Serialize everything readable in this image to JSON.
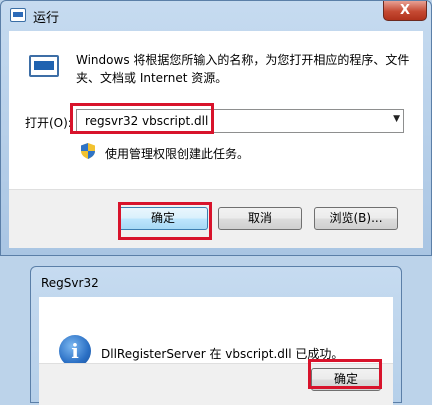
{
  "run_dialog": {
    "title": "运行",
    "close_glyph": "X",
    "description": "Windows 将根据您所输入的名称，为您打开相应的程序、文件夹、文档或 Internet 资源。",
    "open_label": "打开(O):",
    "command_value": "regsvr32 vbscript.dll",
    "admin_note": "使用管理权限创建此任务。",
    "buttons": {
      "ok": "确定",
      "cancel": "取消",
      "browse": "浏览(B)..."
    },
    "highlight_color": "#d8132b"
  },
  "regsvr_dialog": {
    "title": "RegSvr32",
    "message": "DllRegisterServer 在 vbscript.dll 已成功。",
    "ok_label": "确定",
    "icon": "info-icon"
  }
}
